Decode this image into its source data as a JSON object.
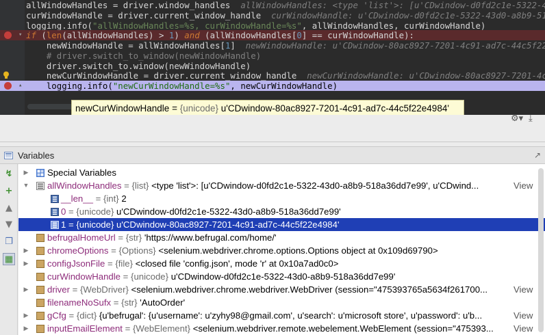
{
  "editor": {
    "lines": [
      {
        "code": "allWindowHandles = driver.window_handles",
        "hint": "allWindowHandles: <type 'list'>: [u'CDwindow-d0fd2c1e-5322-43d0-a"
      },
      {
        "code": "curWindowHandle = driver.current_window_handle",
        "hint": "curWindowHandle: u'CDwindow-d0fd2c1e-5322-43d0-a8b9-518a36dd7"
      },
      {
        "code_pre": "logging.info(",
        "str": "\"allWindowHandles=%s, curWindowHandle=%s\"",
        "code_post": ", allWindowHandles, curWindowHandle)"
      },
      {
        "kw_if": "if",
        "code_a": " (",
        "fn": "len",
        "code_b": "(allWindowHandles) > ",
        "num1": "1",
        "code_c": ") ",
        "kw_and": "and",
        "code_d": " (allWindowHandles[",
        "num2": "0",
        "code_e": "] == curWindowHandle):"
      },
      {
        "code_pre": "    newWindowHandle = allWindowHandles[",
        "num": "1",
        "code_post": "]",
        "hint": "newWindowHandle: u'CDwindow-80ac8927-7201-4c91-ad7c-44c5f22e4984'"
      },
      {
        "comment": "    # driver.switch_to_window(newWindowHandle)"
      },
      {
        "code": "    driver.switch_to.window(newWindowHandle)"
      },
      {
        "code": "    newCurWindowHandle = driver.current_window_handle",
        "hint": "newCurWindowHandle: u'CDwindow-80ac8927-7201-4c91-ad7"
      },
      {
        "code_pre": "    logging.info(",
        "str": "\"newCurWindowHandle=%s\"",
        "code_post": ", newCurWindowHandle)"
      }
    ]
  },
  "tooltip": {
    "name": "newCurWindowHandle",
    "eq": " = ",
    "type": "{unicode}",
    "value": " u'CDwindow-80ac8927-7201-4c91-ad7c-44c5f22e4984'"
  },
  "panel": {
    "title": "Variables",
    "pin_icon": "pin-icon",
    "gear_icon": "gear-icon"
  },
  "variables": [
    {
      "name": "Special Variables",
      "type": "",
      "value": "",
      "expand": "collapsed",
      "icon": "grid-icon"
    },
    {
      "name": "allWindowHandles",
      "type": " = {list} ",
      "value": "<type 'list'>: [u'CDwindow-d0fd2c1e-5322-43d0-a8b9-518a36dd7e99', u'CDwind...",
      "expand": "expanded",
      "icon": "list-icon",
      "view": "View"
    },
    {
      "name": "__len__",
      "type": " = {int} ",
      "value": "2",
      "expand": "none",
      "icon": "list-item-icon"
    },
    {
      "name": "0",
      "type": " = {unicode} ",
      "value": "u'CDwindow-d0fd2c1e-5322-43d0-a8b9-518a36dd7e99'",
      "expand": "none",
      "icon": "list-item-icon"
    },
    {
      "name": "1",
      "type": " = {unicode} ",
      "value": "u'CDwindow-80ac8927-7201-4c91-ad7c-44c5f22e4984'",
      "expand": "none",
      "icon": "list-item-icon",
      "selected": true
    },
    {
      "name": "befrugalHomeUrl",
      "type": " = {str} ",
      "value": "'https://www.befrugal.com/home/'",
      "expand": "none",
      "icon": "variable-icon"
    },
    {
      "name": "chromeOptions",
      "type": " = {Options} ",
      "value": "<selenium.webdriver.chrome.options.Options object at 0x109d69790>",
      "expand": "collapsed",
      "icon": "variable-icon"
    },
    {
      "name": "configJsonFile",
      "type": " = {file} ",
      "value": "<closed file 'config.json', mode 'r' at 0x10a7ad0c0>",
      "expand": "collapsed",
      "icon": "variable-icon"
    },
    {
      "name": "curWindowHandle",
      "type": " = {unicode} ",
      "value": "u'CDwindow-d0fd2c1e-5322-43d0-a8b9-518a36dd7e99'",
      "expand": "none",
      "icon": "variable-icon"
    },
    {
      "name": "driver",
      "type": " = {WebDriver} ",
      "value": "<selenium.webdriver.chrome.webdriver.WebDriver (session=\"475393765a5634f261700...",
      "expand": "collapsed",
      "icon": "variable-icon",
      "view": "View"
    },
    {
      "name": "filenameNoSufx",
      "type": " = {str} ",
      "value": "'AutoOrder'",
      "expand": "none",
      "icon": "variable-icon"
    },
    {
      "name": "gCfg",
      "type": " = {dict} ",
      "value": "{u'befrugal': {u'username': u'zyhy98@gmail.com', u'search': u'microsoft store', u'password': u'b...",
      "expand": "collapsed",
      "icon": "variable-icon",
      "view": "View"
    },
    {
      "name": "inputEmailElement",
      "type": " = {WebElement} ",
      "value": "<selenium.webdriver.remote.webelement.WebElement (session=\"475393...",
      "expand": "collapsed",
      "icon": "variable-icon",
      "view": "View"
    }
  ],
  "side_toolbar": {
    "icons": [
      "evaluate-icon",
      "add-watch-icon",
      "move-up-icon",
      "move-down-icon",
      "copy-icon",
      "watch-toggle-icon"
    ]
  },
  "colors": {
    "editor_bg": "#2b2b2b",
    "breakpoint_line": "#5a2a2c",
    "execution_line": "#b9b4ee",
    "selection": "#1f3fb5",
    "var_name": "#8e2d7b"
  }
}
